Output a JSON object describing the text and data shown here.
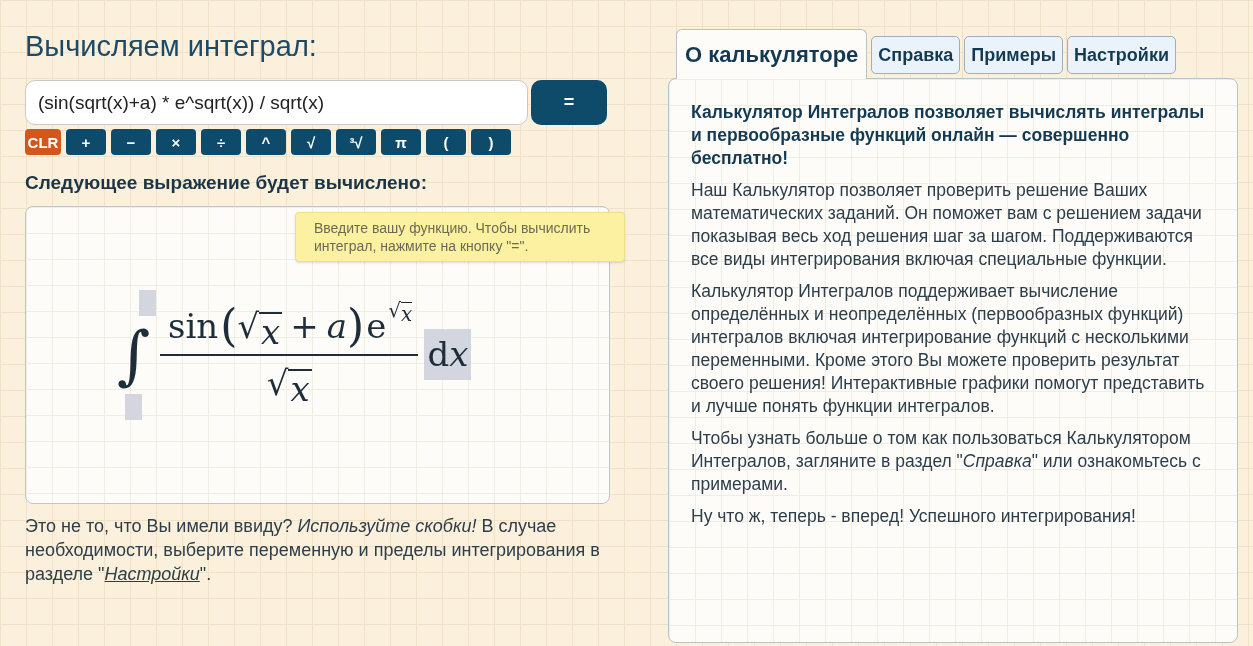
{
  "calculator": {
    "title": "Вычисляем интеграл:",
    "input": {
      "value": "(sin(sqrt(x)+a) * e^sqrt(x)) / sqrt(x)"
    },
    "equals_button": "=",
    "keys": [
      {
        "kind": "clear",
        "label": "CLR"
      },
      {
        "kind": "key",
        "label": "+"
      },
      {
        "kind": "key",
        "label": "−"
      },
      {
        "kind": "key",
        "label": "×"
      },
      {
        "kind": "key",
        "label": "÷"
      },
      {
        "kind": "key",
        "label": "^"
      },
      {
        "kind": "key",
        "label": "√"
      },
      {
        "kind": "key",
        "label": "³√"
      },
      {
        "kind": "key",
        "label": "π"
      },
      {
        "kind": "key",
        "label": "("
      },
      {
        "kind": "key",
        "label": ")"
      }
    ],
    "tooltip": "Введите вашу функцию. Чтобы вычислить интеграл, нажмите на кнопку \"=\".",
    "preview_heading": "Следующее выражение будет вычислено:",
    "formula": {
      "integral_sign": "∫",
      "numerator": [
        {
          "kind": "fn",
          "text": "sin"
        },
        {
          "kind": "paren",
          "text": "("
        },
        {
          "kind": "sqrt",
          "sign": "√",
          "text": "x"
        },
        {
          "kind": "op",
          "text": "+"
        },
        {
          "kind": "var",
          "text": "a"
        },
        {
          "kind": "paren",
          "text": ")"
        },
        {
          "kind": "fn",
          "text": "e"
        },
        {
          "kind": "sup_sqrt",
          "sign": "√",
          "text": "x"
        }
      ],
      "denominator": [
        {
          "kind": "sqrt",
          "sign": "√",
          "text": "x"
        }
      ],
      "differential": "dx"
    },
    "note": {
      "text": "Это не то, что Вы имели ввиду? *Используйте скобки!* В случае необходимости, выберите переменную и пределы интегрирования в разделе \"",
      "link": "Настройки",
      "after": "\"."
    }
  },
  "info_panel": {
    "tabs": [
      {
        "label": "О калькуляторе",
        "selected": true
      },
      {
        "label": "Справка",
        "selected": false
      },
      {
        "label": "Примеры",
        "selected": false
      },
      {
        "label": "Настройки",
        "selected": false
      }
    ],
    "paragraphs": [
      {
        "kind": "lead",
        "text": "Калькулятор Интегралов позволяет вычислять интегралы и первообразные функций онлайн — совершенно бесплатно!"
      },
      {
        "kind": "body",
        "text": "Наш Калькулятор позволяет проверить решение Ваших математических заданий. Он поможет вам с решением задачи показывая весь ход решения шаг за шагом. Поддерживаются все виды интегрирования включая специальные функции."
      },
      {
        "kind": "body",
        "text": "Калькулятор Интегралов поддерживает вычисление определённых и неопределённых (первообразных функций) интегралов включая интегрирование функций с несколькими переменными. Кроме этого Вы можете проверить результат своего решения! Интерактивные графики помогут представить и лучше понять функции интегралов."
      },
      {
        "kind": "body",
        "text": "Чтобы узнать больше о том как пользоваться Калькулятором Интегралов, загляните в раздел \"*Справка*\" или ознакомьтесь с примерами."
      },
      {
        "kind": "body",
        "text": "Ну что ж, теперь - вперед! Успешного интегрирования!"
      }
    ]
  }
}
